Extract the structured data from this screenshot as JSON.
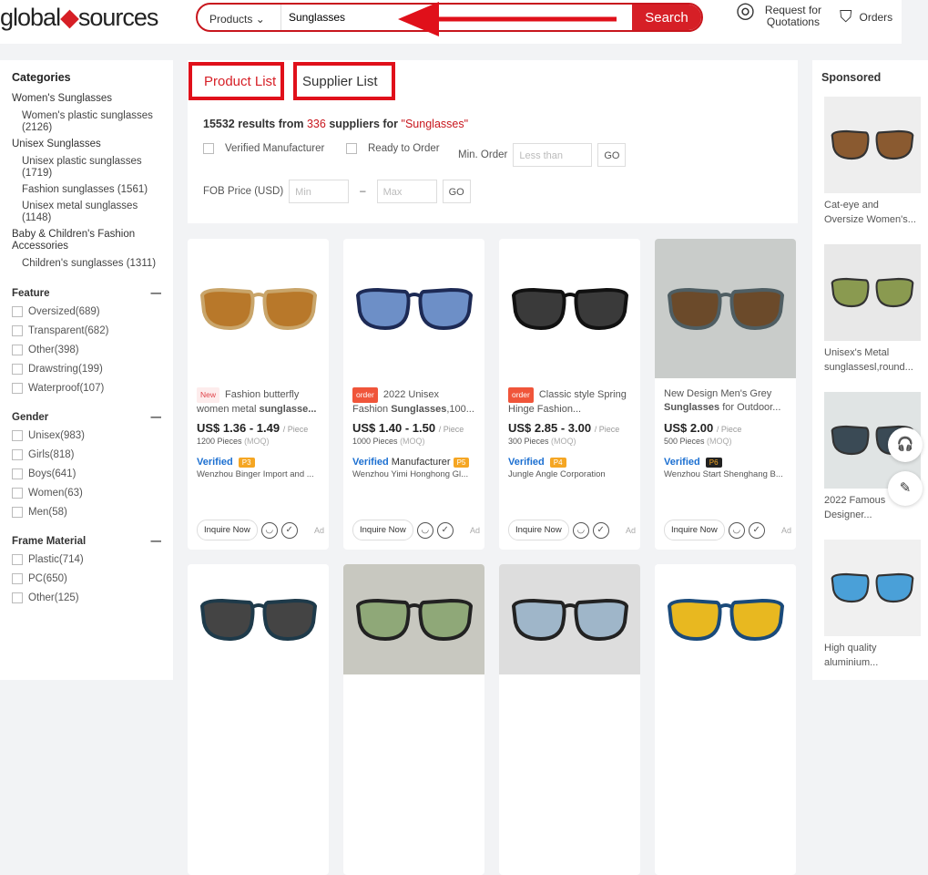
{
  "header": {
    "logo_a": "global",
    "logo_b": "sources",
    "search_category": "Products",
    "search_value": "Sunglasses",
    "search_button": "Search",
    "rfq": "Request for Quotations",
    "orders": "Orders"
  },
  "tabs": {
    "product_list": "Product List",
    "supplier_list": "Supplier List"
  },
  "results": {
    "count": "15532",
    "mid": "results from",
    "suppliers": "336",
    "suffix": "suppliers for",
    "query": "\"Sunglasses\""
  },
  "filters": {
    "verified": "Verified Manufacturer",
    "ready": "Ready to Order",
    "min_order": "Min. Order",
    "min_order_ph": "Less than",
    "go": "GO",
    "fob": "FOB Price (USD)",
    "min_ph": "Min",
    "dash": "–",
    "max_ph": "Max"
  },
  "sidebar": {
    "title": "Categories",
    "groups": [
      {
        "label": "Women's Sunglasses",
        "subs": [
          "Women's plastic sunglasses (2126)"
        ]
      },
      {
        "label": "Unisex Sunglasses",
        "subs": [
          "Unisex plastic sunglasses (1719)",
          "Fashion sunglasses (1561)",
          "Unisex metal sunglasses (1148)"
        ]
      },
      {
        "label": "Baby & Children's Fashion Accessories",
        "subs": [
          "Children's sunglasses (1311)"
        ]
      }
    ],
    "sections": [
      {
        "title": "Feature",
        "items": [
          "Oversized(689)",
          "Transparent(682)",
          "Other(398)",
          "Drawstring(199)",
          "Waterproof(107)"
        ]
      },
      {
        "title": "Gender",
        "items": [
          "Unisex(983)",
          "Girls(818)",
          "Boys(641)",
          "Women(63)",
          "Men(58)"
        ]
      },
      {
        "title": "Frame Material",
        "items": [
          "Plastic(714)",
          "PC(650)",
          "Other(125)"
        ]
      }
    ]
  },
  "products": [
    {
      "badge": "New",
      "title": "Fashion butterfly women metal ",
      "bold": "sunglasse...",
      "price": "US$ 1.36 - 1.49",
      "unit": "/ Piece",
      "moq": "1200 Pieces",
      "moq_tag": "(MOQ)",
      "verified": "Verified",
      "manufacturer": "",
      "level": "P3",
      "company": "Wenzhou Binger Import and ...",
      "inquire": "Inquire Now",
      "ad": "Ad"
    },
    {
      "badge": "order",
      "title": "2022 Unisex Fashion ",
      "bold": "Sunglasses",
      "tail": ",100...",
      "price": "US$ 1.40 - 1.50",
      "unit": "/ Piece",
      "moq": "1000 Pieces",
      "moq_tag": "(MOQ)",
      "verified": "Verified",
      "manufacturer": "Manufacturer",
      "level": "P5",
      "company": "Wenzhou Yimi Honghong Gl...",
      "inquire": "Inquire Now",
      "ad": "Ad"
    },
    {
      "badge": "order",
      "title": "Classic style Spring Hinge Fashion...",
      "bold": "",
      "price": "US$ 2.85 - 3.00",
      "unit": "/ Piece",
      "moq": "300 Pieces",
      "moq_tag": "(MOQ)",
      "verified": "Verified",
      "manufacturer": "",
      "level": "P4",
      "company": "Jungle Angle Corporation",
      "inquire": "Inquire Now",
      "ad": "Ad"
    },
    {
      "badge": "",
      "title": "New Design Men's Grey ",
      "bold": "Sunglasses",
      "tail": " for Outdoor...",
      "price": "US$ 2.00",
      "unit": "/ Piece",
      "moq": "500 Pieces",
      "moq_tag": "(MOQ)",
      "verified": "Verified",
      "manufacturer": "",
      "level": "P6",
      "company": "Wenzhou Start Shenghang B...",
      "inquire": "Inquire Now",
      "ad": "Ad"
    }
  ],
  "sponsored": {
    "title": "Sponsored",
    "items": [
      "Cat-eye and Oversize Women's...",
      "Unisex's Metal sunglassesl,round...",
      "2022 Famous Designer...",
      "High quality aluminium..."
    ]
  },
  "colors": {
    "brand": "#d61f26",
    "verified": "#1b6fd1",
    "level": "#f5a623"
  }
}
